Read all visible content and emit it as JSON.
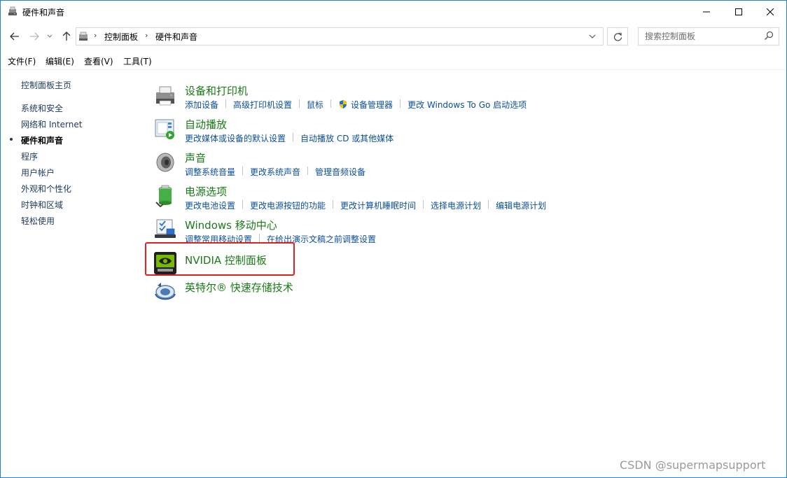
{
  "window": {
    "title": "硬件和声音",
    "controls": {
      "minimize": "—",
      "maximize": "☐",
      "close": "✕"
    }
  },
  "navigation": {
    "back_icon": "←",
    "forward_icon": "→",
    "recent_icon": "˅",
    "up_icon": "↑",
    "breadcrumb": [
      "控制面板",
      "硬件和声音"
    ],
    "refresh_icon": "↻"
  },
  "search": {
    "placeholder": "搜索控制面板",
    "value": ""
  },
  "menu": [
    "文件(F)",
    "编辑(E)",
    "查看(V)",
    "工具(T)"
  ],
  "sidebar": {
    "home": "控制面板主页",
    "items": [
      {
        "label": "系统和安全",
        "current": false
      },
      {
        "label": "网络和 Internet",
        "current": false
      },
      {
        "label": "硬件和声音",
        "current": true
      },
      {
        "label": "程序",
        "current": false
      },
      {
        "label": "用户帐户",
        "current": false
      },
      {
        "label": "外观和个性化",
        "current": false
      },
      {
        "label": "时钟和区域",
        "current": false
      },
      {
        "label": "轻松使用",
        "current": false
      }
    ]
  },
  "categories": [
    {
      "title": "设备和打印机",
      "icon": "printer-icon",
      "links": [
        "添加设备",
        "高级打印机设置",
        "鼠标",
        "设备管理器",
        "更改 Windows To Go 启动选项"
      ]
    },
    {
      "title": "自动播放",
      "icon": "autoplay-icon",
      "links": [
        "更改媒体或设备的默认设置",
        "自动播放 CD 或其他媒体"
      ]
    },
    {
      "title": "声音",
      "icon": "speaker-icon",
      "links": [
        "调整系统音量",
        "更改系统声音",
        "管理音频设备"
      ]
    },
    {
      "title": "电源选项",
      "icon": "battery-icon",
      "links": [
        "更改电池设置",
        "更改电源按钮的功能",
        "更改计算机睡眠时间",
        "选择电源计划",
        "编辑电源计划"
      ]
    },
    {
      "title": "Windows 移动中心",
      "icon": "mobility-center-icon",
      "links": [
        "调整常用移动设置",
        "在给出演示文稿之前调整设置"
      ]
    },
    {
      "title": "NVIDIA 控制面板",
      "icon": "nvidia-icon",
      "links": []
    },
    {
      "title": "英特尔® 快速存储技术",
      "icon": "intel-rst-icon",
      "links": []
    }
  ],
  "watermark": "CSDN @supermapsupport",
  "colors": {
    "category_title": "#1a7a17",
    "link": "#0b4f99",
    "highlight": "#e02020",
    "window_border": "#1883d7"
  }
}
